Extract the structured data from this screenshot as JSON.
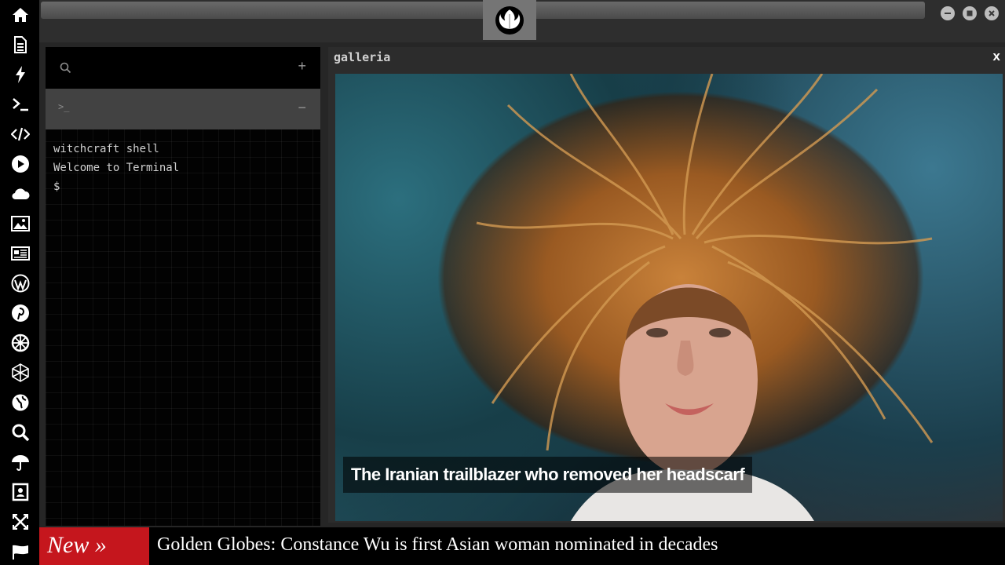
{
  "sidebar": {
    "icons": [
      "home-icon",
      "document-icon",
      "bolt-icon",
      "terminal-icon",
      "code-icon",
      "play-icon",
      "cloud-icon",
      "image-icon",
      "newspaper-icon",
      "wordpress-icon",
      "pinterest-icon",
      "settings-wheel-icon",
      "globe-wire-icon",
      "globe-icon",
      "search-icon",
      "umbrella-icon",
      "contact-icon",
      "expand-icon",
      "flag-icon"
    ]
  },
  "terminal": {
    "prompt_icon": ">_",
    "plus_label": "+",
    "minus_label": "−",
    "lines": [
      "witchcraft shell",
      "Welcome to Terminal",
      "$"
    ]
  },
  "gallery": {
    "title": "galleria",
    "close_label": "x",
    "caption": "The Iranian trailblazer who removed her headscarf"
  },
  "ticker": {
    "badge": "New »",
    "headline": "Golden Globes: Constance Wu is first Asian woman nominated in decades"
  },
  "colors": {
    "ticker_badge": "#c5161d",
    "sidebar_bg": "#000000",
    "terminal_tab_bg": "#424242"
  }
}
